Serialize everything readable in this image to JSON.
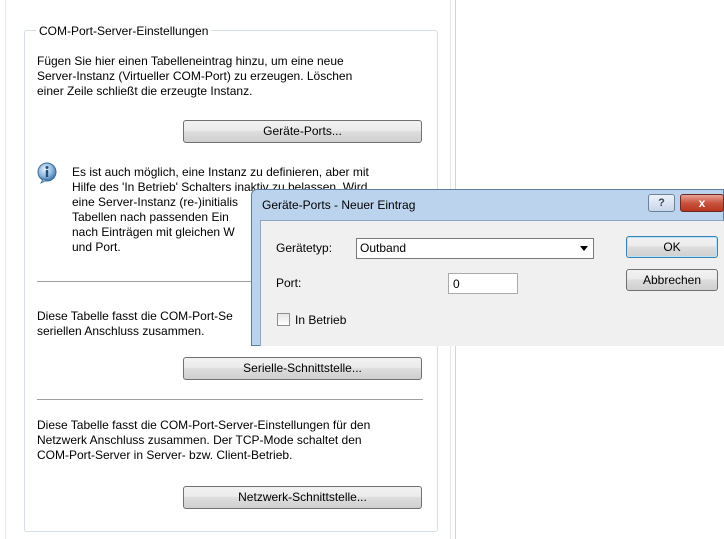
{
  "panel": {
    "group_title": "COM-Port-Server-Einstellungen",
    "intro_text": "Fügen Sie hier einen Tabelleneintrag hinzu, um eine neue\nServer-Instanz (Virtueller COM-Port) zu erzeugen. Löschen\neiner Zeile schließt die erzeugte Instanz.",
    "devices_button": "Geräte-Ports...",
    "info_text": "Es ist auch möglich, eine Instanz zu definieren, aber mit\nHilfe des 'In Betrieb' Schalters inaktiv zu belassen. Wird\neine Server-Instanz (re-)initialis\nTabellen nach passenden Ein\nnach Einträgen mit gleichen W\nund Port.",
    "serial_text": "Diese Tabelle fasst die COM-Port-Se\nseriellen Anschluss zusammen.",
    "serial_button": "Serielle-Schnittstelle...",
    "network_text": "Diese Tabelle fasst die COM-Port-Server-Einstellungen für den\nNetzwerk Anschluss zusammen. Der TCP-Mode schaltet den\nCOM-Port-Server in Server- bzw. Client-Betrieb.",
    "network_button": "Netzwerk-Schnittstelle..."
  },
  "dialog": {
    "title": "Geräte-Ports - Neuer Eintrag",
    "help_label": "?",
    "close_label": "x",
    "device_type_label": "Gerätetyp:",
    "device_type_value": "Outband",
    "port_label": "Port:",
    "port_value": "0",
    "active_label": "In Betrieb",
    "active_checked": false,
    "ok_label": "OK",
    "cancel_label": "Abbrechen"
  }
}
